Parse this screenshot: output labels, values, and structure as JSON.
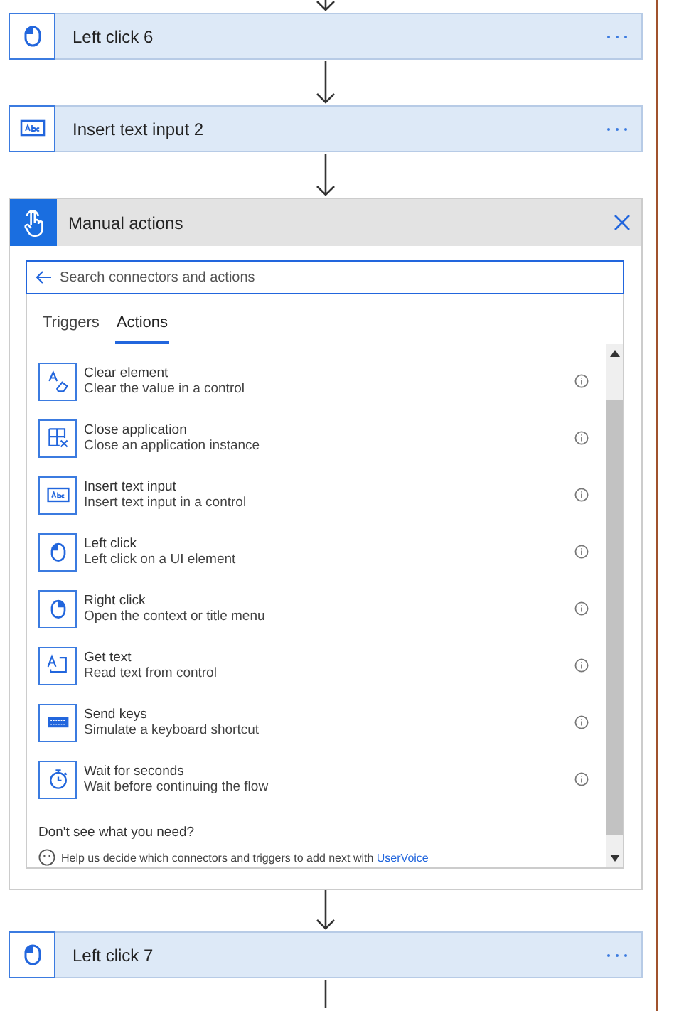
{
  "steps_before": [
    {
      "title": "Left click 6",
      "kind": "mouse"
    },
    {
      "title": "Insert text input 2",
      "kind": "text-input"
    }
  ],
  "panel": {
    "title": "Manual actions",
    "search": {
      "placeholder": "Search connectors and actions"
    },
    "tabs": [
      {
        "label": "Triggers",
        "selected": false
      },
      {
        "label": "Actions",
        "selected": true
      }
    ],
    "actions": [
      {
        "kind": "clear",
        "title": "Clear element",
        "description": "Clear the value in a control"
      },
      {
        "kind": "close",
        "title": "Close application",
        "description": "Close an application instance"
      },
      {
        "kind": "text-input",
        "title": "Insert text input",
        "description": "Insert text input in a control"
      },
      {
        "kind": "mouse",
        "title": "Left click",
        "description": "Left click on a UI element"
      },
      {
        "kind": "right-mouse",
        "title": "Right click",
        "description": "Open the context or title menu"
      },
      {
        "kind": "get-text",
        "title": "Get text",
        "description": "Read text from control"
      },
      {
        "kind": "keyboard",
        "title": "Send keys",
        "description": "Simulate a keyboard shortcut"
      },
      {
        "kind": "timer",
        "title": "Wait for seconds",
        "description": "Wait before continuing the flow"
      }
    ],
    "footer": {
      "question": "Don't see what you need?",
      "help": "Help us decide which connectors and triggers to add next with",
      "link": "UserVoice"
    }
  },
  "steps_after": [
    {
      "title": "Left click 7",
      "kind": "mouse"
    }
  ]
}
